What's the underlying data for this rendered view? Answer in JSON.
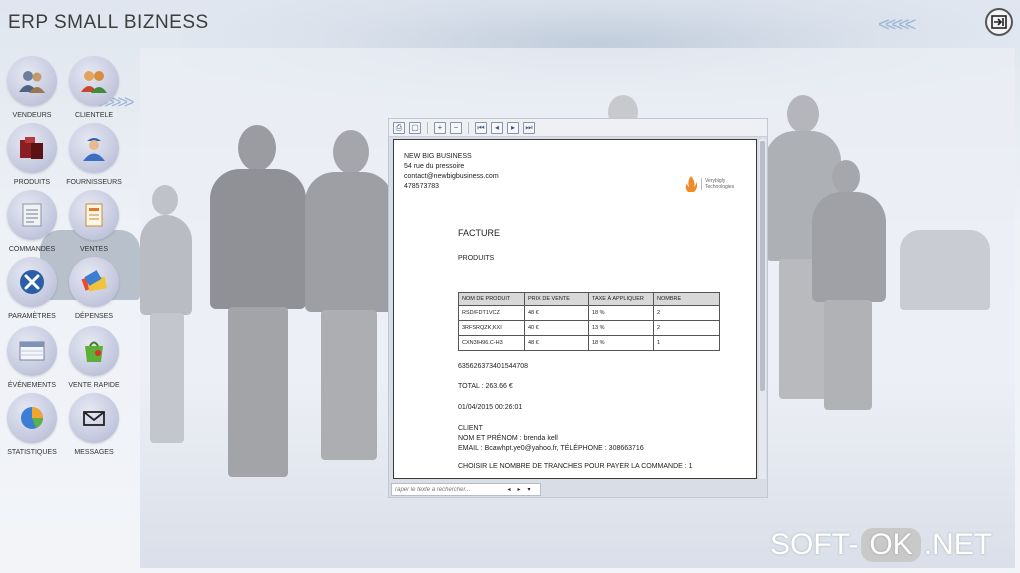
{
  "app": {
    "title": "ERP SMALL BIZNESS"
  },
  "toolbar": {
    "exit_icon": "exit-icon"
  },
  "sidebar": {
    "items": [
      {
        "label": "VENDEURS",
        "icon": "sellers-icon"
      },
      {
        "label": "CLIENTELE",
        "icon": "clients-icon"
      },
      {
        "label": "PRODUITS",
        "icon": "products-icon"
      },
      {
        "label": "FOURNISSEURS",
        "icon": "supplier-icon"
      },
      {
        "label": "COMMANDES",
        "icon": "orders-icon"
      },
      {
        "label": "VENTES",
        "icon": "sales-icon"
      },
      {
        "label": "PARAMÈTRES",
        "icon": "settings-icon"
      },
      {
        "label": "DÉPENSES",
        "icon": "expenses-icon"
      },
      {
        "label": "ÉVÉNEMENTS",
        "icon": "calendar-icon"
      },
      {
        "label": "VENTE RAPIDE",
        "icon": "quick-sale-icon"
      },
      {
        "label": "STATISTIQUES",
        "icon": "pie-chart-icon"
      },
      {
        "label": "MESSAGES",
        "icon": "envelope-icon"
      }
    ]
  },
  "viewer": {
    "toolbar_icons": [
      "print-icon",
      "page-setup-icon",
      "zoom-in-icon",
      "zoom-out-icon",
      "first-page-icon",
      "previous-page-icon",
      "next-page-icon",
      "last-page-icon"
    ],
    "search_placeholder": "Taper le texte à rechercher...",
    "company": {
      "name": "NEW BIG BUSINESS",
      "address": "54 rue du pressoire",
      "email": "contact@newbigbusiness.com",
      "phone": "478573783"
    },
    "logo": {
      "line1": "Verybigly",
      "line2": "Technologies"
    },
    "doc": {
      "title": "FACTURE",
      "section": "PRODUITS",
      "table": {
        "headers": [
          "NOM DE PRODUIT",
          "PRIX DE VENTE",
          "TAXE À APPLIQUER",
          "NOMBRE"
        ],
        "rows": [
          [
            "RSD/FDT1VCZ",
            "48 €",
            "18 %",
            "2"
          ],
          [
            "3RFSRQZK,KXI",
            "40 €",
            "13 %",
            "2"
          ],
          [
            "CXN3IH96.C-H3",
            "48 €",
            "18 %",
            "1"
          ]
        ]
      },
      "reference": "635626373401544708",
      "total": "TOTAL : 263.66  €",
      "date": "01/04/2015 00:26:01",
      "client_header": "CLIENT",
      "client_name": "NOM ET PRÉNOM : brenda kell",
      "client_contact": "EMAIL : Bcawhpt.ye0@yahoo.fr, TÉLÉPHONE : 308663716",
      "installments": "CHOISIR LE NOMBRE DE TRANCHES POUR PAYER LA COMMANDE : 1"
    }
  },
  "watermark": {
    "left": "SOFT-",
    "mid": "OK",
    "right": ".NET"
  }
}
